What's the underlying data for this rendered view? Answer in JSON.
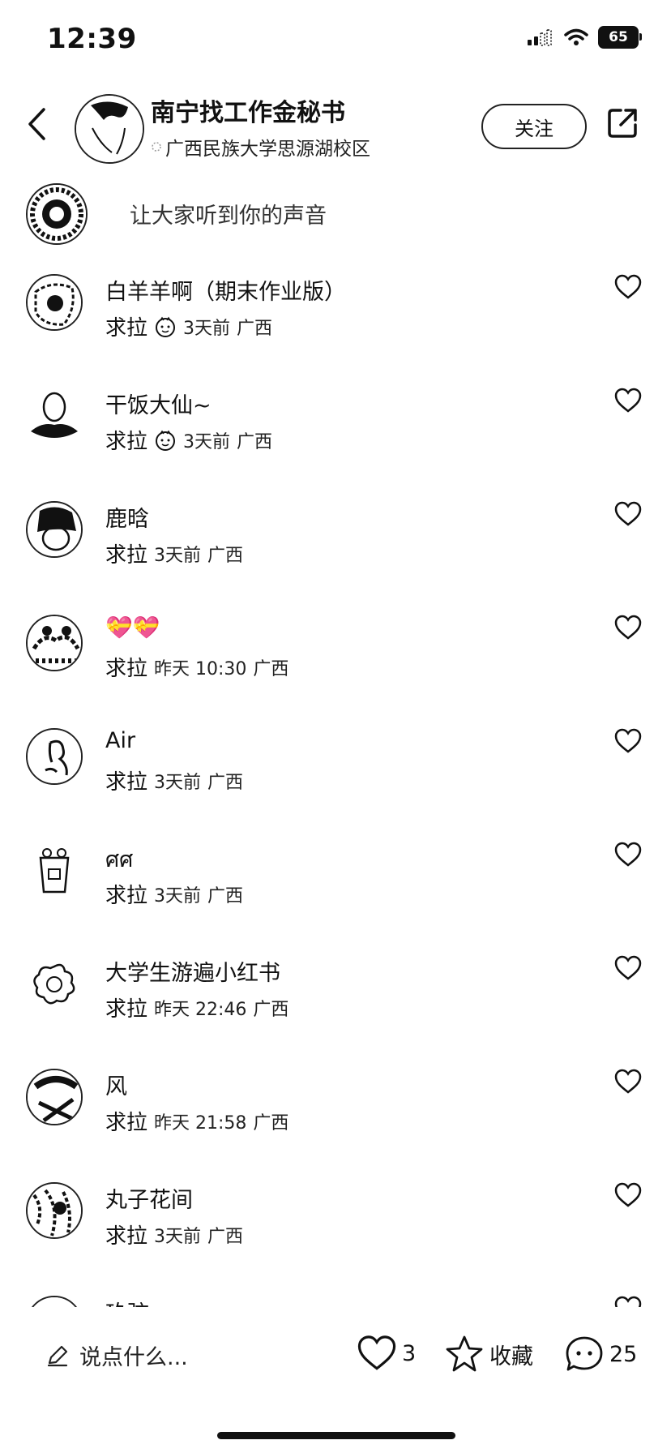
{
  "status": {
    "time": "12:39",
    "battery": "65"
  },
  "header": {
    "account_name": "南宁找工作金秘书",
    "location": "广西民族大学思源湖校区",
    "follow_label": "关注"
  },
  "prompt": {
    "text": "让大家听到你的声音"
  },
  "comments": [
    {
      "name": "白羊羊啊（期末作业版）",
      "reply": "求拉",
      "emoji": true,
      "time": "3天前",
      "region": "广西"
    },
    {
      "name": "干饭大仙~",
      "reply": "求拉",
      "emoji": true,
      "time": "3天前",
      "region": "广西"
    },
    {
      "name": "鹿晗",
      "reply": "求拉",
      "emoji": false,
      "time": "3天前",
      "region": "广西"
    },
    {
      "name": "💝💝",
      "reply": "求拉",
      "emoji": false,
      "time": "昨天 10:30",
      "region": "广西"
    },
    {
      "name": " Air",
      "reply": "求拉",
      "emoji": false,
      "time": "3天前",
      "region": "广西"
    },
    {
      "name": " ศศ",
      "reply": "求拉",
      "emoji": false,
      "time": "3天前",
      "region": "广西"
    },
    {
      "name": "大学生游遍小红书",
      "reply": "求拉",
      "emoji": false,
      "time": "昨天 22:46",
      "region": "广西"
    },
    {
      "name": "风",
      "reply": "求拉",
      "emoji": false,
      "time": "昨天 21:58",
      "region": "广西"
    },
    {
      "name": "丸子花间",
      "reply": "求拉",
      "emoji": false,
      "time": "3天前",
      "region": "广西"
    },
    {
      "name": "玖弦",
      "reply": "",
      "emoji": false,
      "time": "",
      "region": ""
    }
  ],
  "bottom": {
    "input_placeholder": "说点什么...",
    "likes": "3",
    "favorite_label": "收藏",
    "comments_count": "25"
  }
}
